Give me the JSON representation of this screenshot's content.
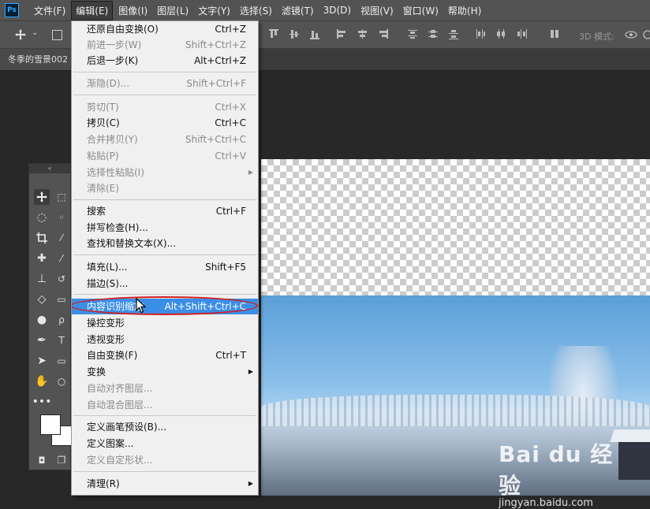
{
  "menubar": {
    "app_icon": "Ps",
    "items": [
      {
        "label": "文件(F)"
      },
      {
        "label": "编辑(E)"
      },
      {
        "label": "图像(I)"
      },
      {
        "label": "图层(L)"
      },
      {
        "label": "文字(Y)"
      },
      {
        "label": "选择(S)"
      },
      {
        "label": "滤镜(T)"
      },
      {
        "label": "3D(D)"
      },
      {
        "label": "视图(V)"
      },
      {
        "label": "窗口(W)"
      },
      {
        "label": "帮助(H)"
      }
    ]
  },
  "optionsbar": {
    "mode_3d_label": "3D 模式:"
  },
  "document_tab": {
    "title": "冬季的雪景002"
  },
  "edit_menu": {
    "items": [
      {
        "label": "还原自由变换(O)",
        "shortcut": "Ctrl+Z"
      },
      {
        "label": "前进一步(W)",
        "shortcut": "Shift+Ctrl+Z"
      },
      {
        "label": "后退一步(K)",
        "shortcut": "Alt+Ctrl+Z"
      },
      {
        "label": "渐隐(D)...",
        "shortcut": "Shift+Ctrl+F"
      },
      {
        "label": "剪切(T)",
        "shortcut": "Ctrl+X"
      },
      {
        "label": "拷贝(C)",
        "shortcut": "Ctrl+C"
      },
      {
        "label": "合并拷贝(Y)",
        "shortcut": "Shift+Ctrl+C"
      },
      {
        "label": "粘贴(P)",
        "shortcut": "Ctrl+V"
      },
      {
        "label": "选择性粘贴(I)",
        "shortcut": ""
      },
      {
        "label": "清除(E)",
        "shortcut": ""
      },
      {
        "label": "搜索",
        "shortcut": "Ctrl+F"
      },
      {
        "label": "拼写检查(H)...",
        "shortcut": ""
      },
      {
        "label": "查找和替换文本(X)...",
        "shortcut": ""
      },
      {
        "label": "填充(L)...",
        "shortcut": "Shift+F5"
      },
      {
        "label": "描边(S)...",
        "shortcut": ""
      },
      {
        "label": "内容识别缩放",
        "shortcut": "Alt+Shift+Ctrl+C"
      },
      {
        "label": "操控变形",
        "shortcut": ""
      },
      {
        "label": "透视变形",
        "shortcut": ""
      },
      {
        "label": "自由变换(F)",
        "shortcut": "Ctrl+T"
      },
      {
        "label": "变换",
        "shortcut": ""
      },
      {
        "label": "自动对齐图层...",
        "shortcut": ""
      },
      {
        "label": "自动混合图层...",
        "shortcut": ""
      },
      {
        "label": "定义画笔预设(B)...",
        "shortcut": ""
      },
      {
        "label": "定义图案...",
        "shortcut": ""
      },
      {
        "label": "定义自定形状...",
        "shortcut": ""
      },
      {
        "label": "清理(R)",
        "shortcut": ""
      }
    ]
  },
  "watermark": {
    "brand": "Bai du 经验",
    "url": "jingyan.baidu.com"
  },
  "colors": {
    "menu_highlight": "#3b8ee6",
    "annotation_ring": "#d31d1d",
    "ps_brand": "#31a8ff"
  }
}
